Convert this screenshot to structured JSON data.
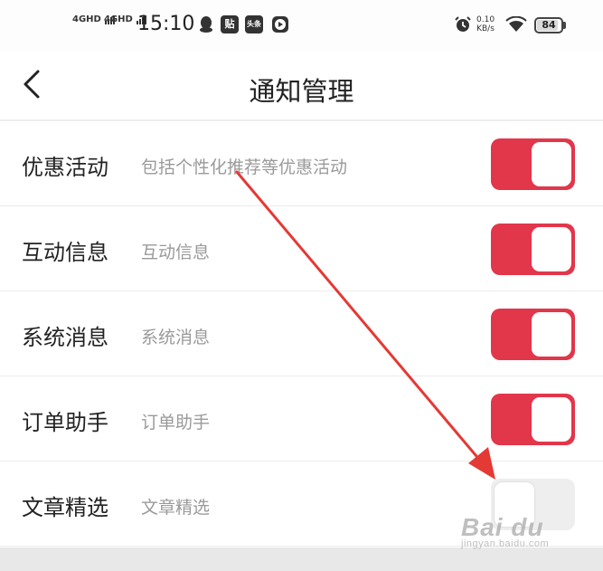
{
  "status_bar": {
    "signal_1": "4GHD",
    "signal_2": "4GHD",
    "time": "15:10",
    "icons": [
      "qq-icon",
      "tie-icon",
      "toutiao-icon",
      "play-icon"
    ],
    "icon_labels": {
      "tie": "贴",
      "toutiao": "头条"
    },
    "alarm_icon": "alarm-icon",
    "net_speed_value": "0.10",
    "net_speed_unit": "KB/s",
    "wifi_icon": "wifi-icon",
    "battery_level": "84"
  },
  "nav": {
    "back_icon": "chevron-left-icon",
    "title": "通知管理"
  },
  "settings": [
    {
      "title": "优惠活动",
      "description": "包括个性化推荐等优惠活动",
      "enabled": true
    },
    {
      "title": "互动信息",
      "description": "互动信息",
      "enabled": true
    },
    {
      "title": "系统消息",
      "description": "系统消息",
      "enabled": true
    },
    {
      "title": "订单助手",
      "description": "订单助手",
      "enabled": true
    },
    {
      "title": "文章精选",
      "description": "文章精选",
      "enabled": false
    }
  ],
  "annotation": {
    "type": "red-arrow",
    "color": "#e53935"
  },
  "watermark": {
    "brand": "Bai du",
    "url": "jingyan.baidu.com"
  },
  "colors": {
    "toggle_on": "#e2364b",
    "toggle_off": "#eeeeee",
    "accent_arrow": "#e53935"
  }
}
